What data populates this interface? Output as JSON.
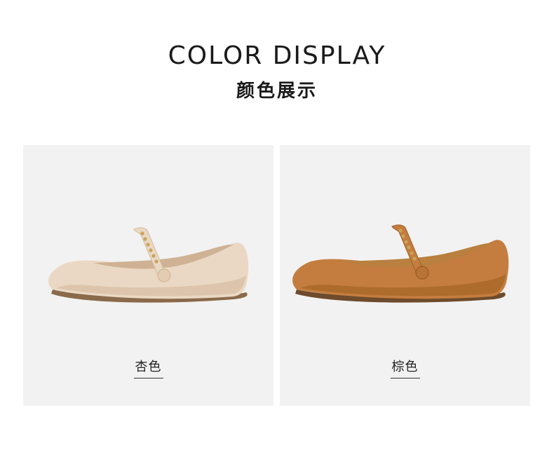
{
  "header": {
    "title_en": "COLOR DISPLAY",
    "title_cn": "颜色展示"
  },
  "products": [
    {
      "label": "杏色",
      "color": "#ead8c4",
      "shade": "#d8c0a6",
      "lining": "#cfb294"
    },
    {
      "label": "棕色",
      "color": "#c47d3e",
      "shade": "#a86628",
      "lining": "#b9803f"
    }
  ],
  "colors": {
    "card_bg": "#f2f2f2",
    "sole": "#8a6a4a",
    "chain": "#c9a45a"
  }
}
